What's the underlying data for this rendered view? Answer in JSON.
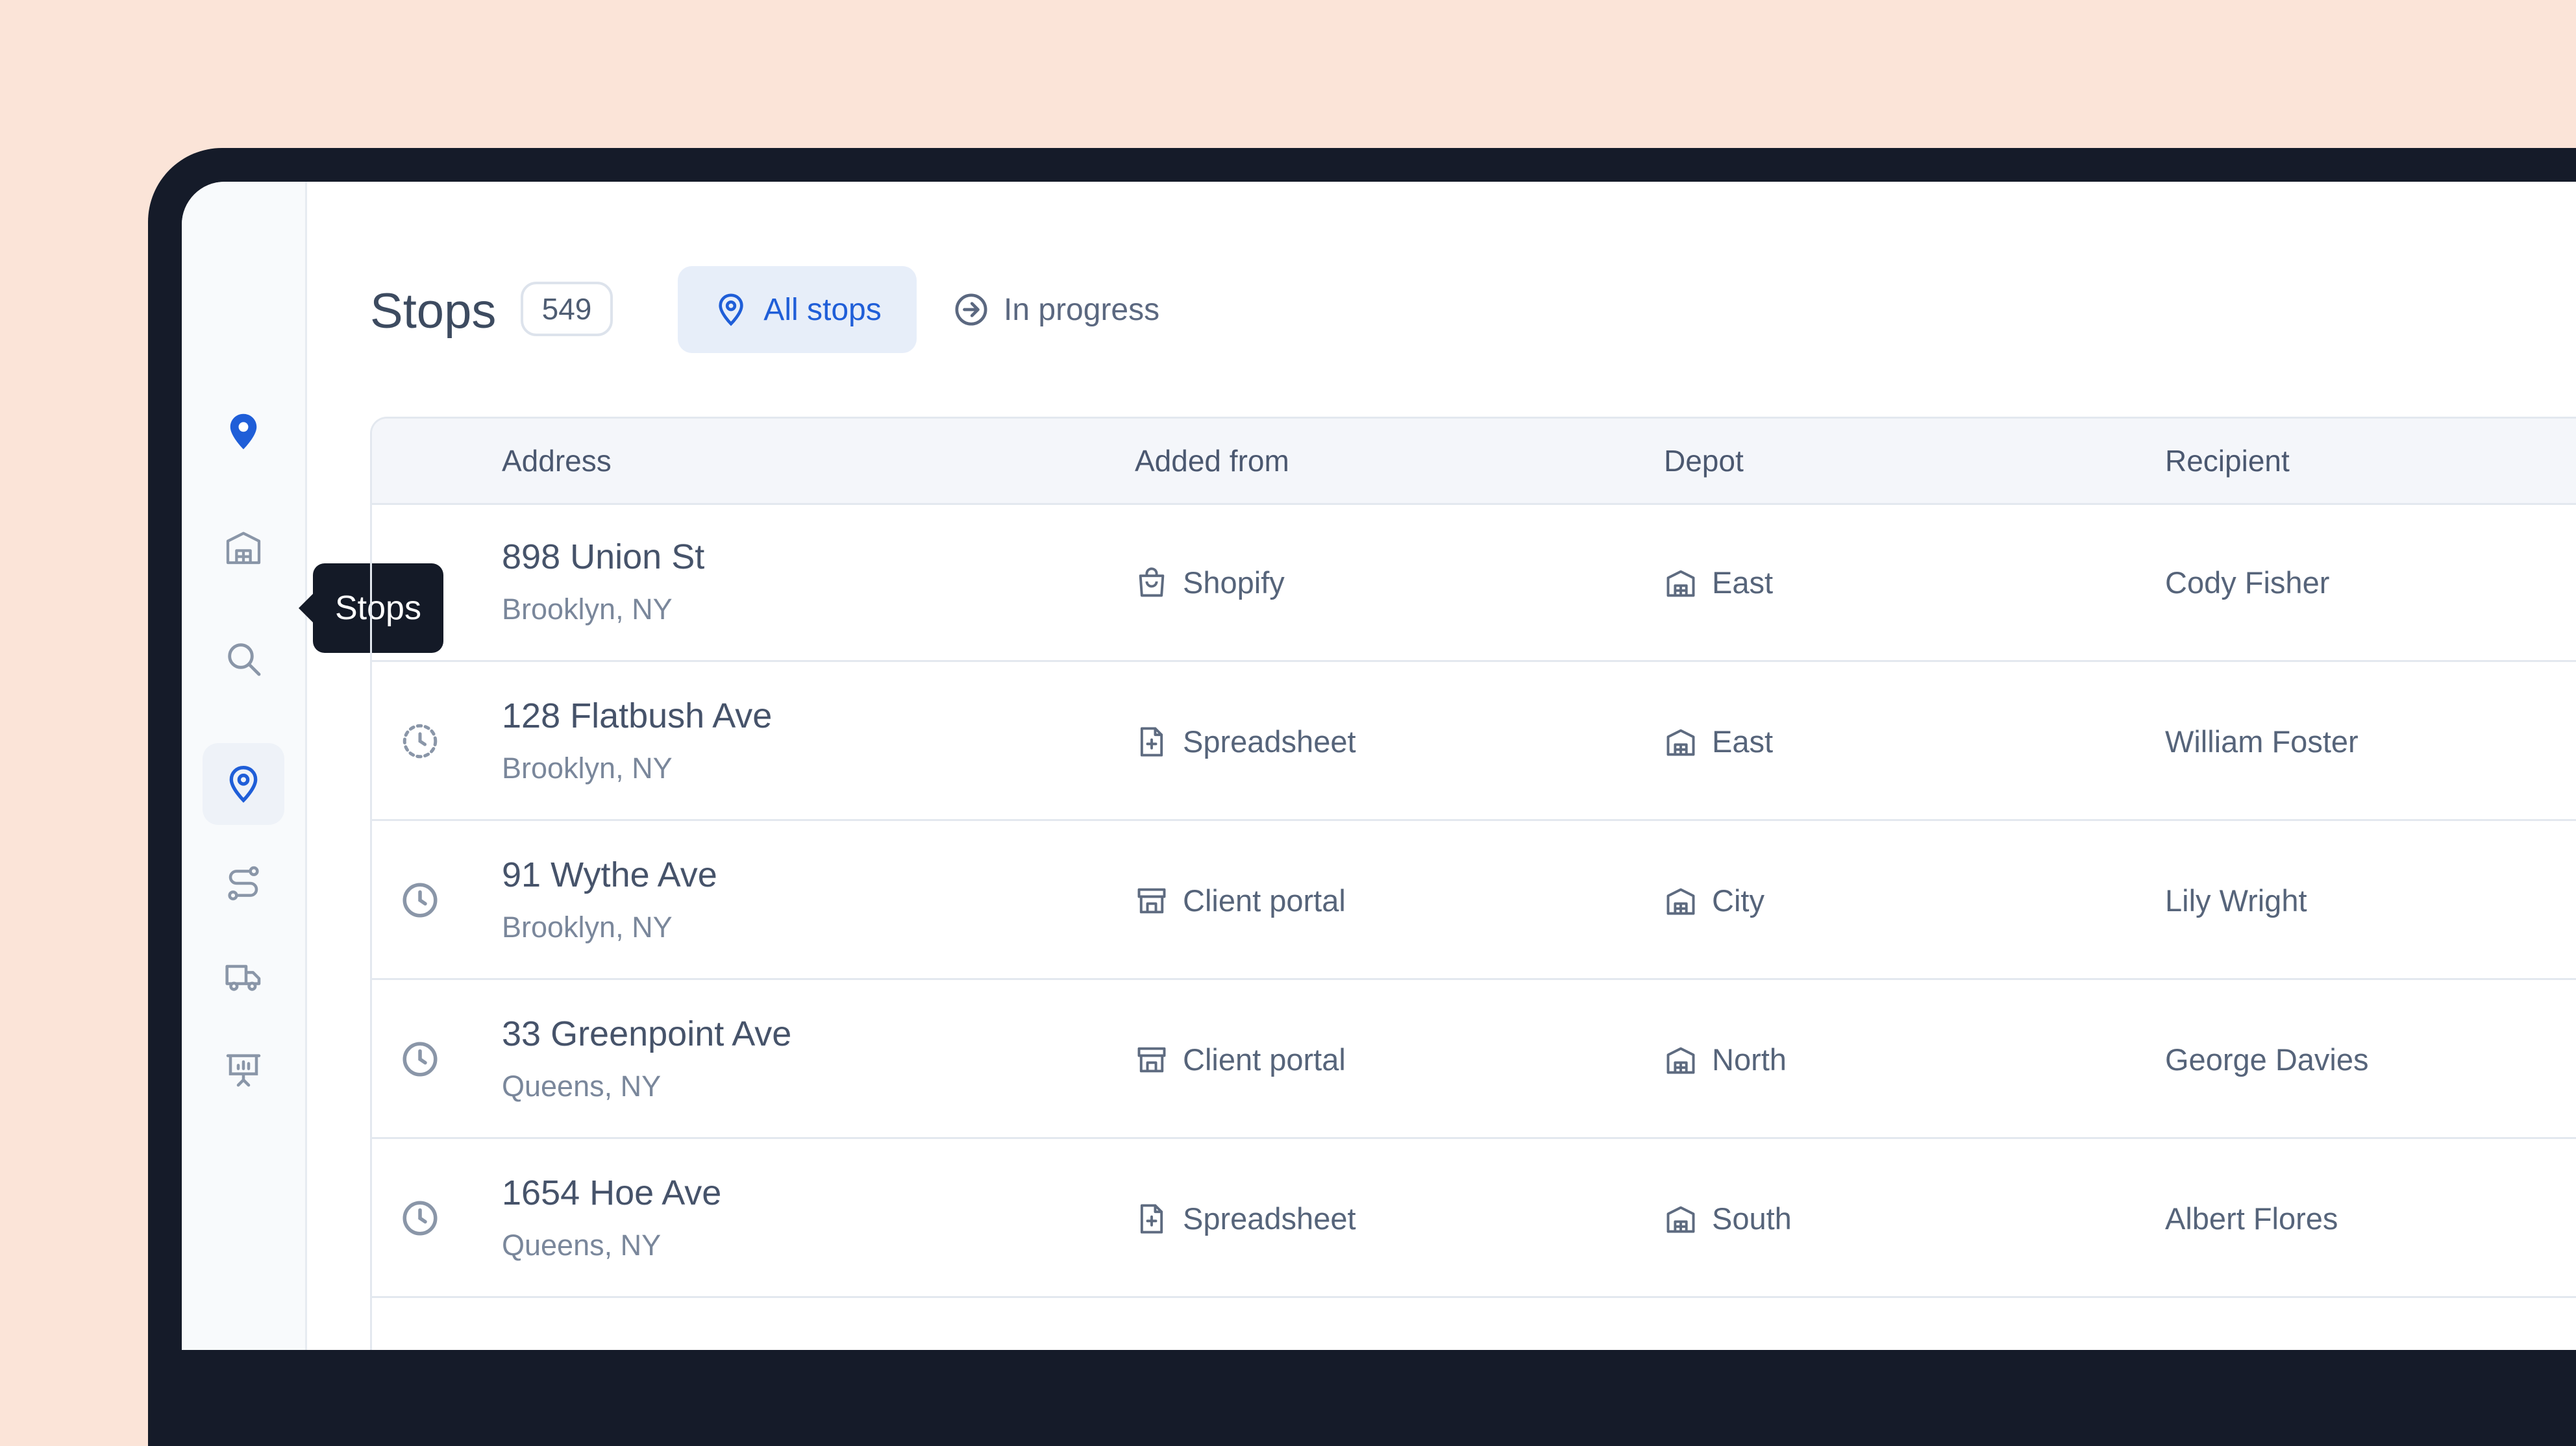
{
  "sidebar": {
    "items": [
      {
        "name": "logo",
        "icon": "map-pin-icon"
      },
      {
        "name": "depots",
        "icon": "warehouse-icon"
      },
      {
        "name": "search",
        "icon": "search-icon"
      },
      {
        "name": "stops",
        "icon": "map-pin-icon",
        "active": true
      },
      {
        "name": "routes",
        "icon": "route-icon"
      },
      {
        "name": "vehicles",
        "icon": "truck-icon"
      },
      {
        "name": "reports",
        "icon": "presentation-chart-icon"
      }
    ],
    "tooltip": "Stops"
  },
  "header": {
    "title": "Stops",
    "count": "549",
    "tabs": [
      {
        "label": "All stops",
        "icon": "map-pin-icon",
        "active": true
      },
      {
        "label": "In progress",
        "icon": "arrow-circle-right-icon",
        "active": false
      }
    ]
  },
  "table": {
    "columns": [
      "Address",
      "Added from",
      "Depot",
      "Recipient"
    ],
    "rows": [
      {
        "status": "none",
        "address": "898 Union St",
        "city": "Brooklyn, NY",
        "source": "Shopify",
        "source_icon": "shopping-bag-icon",
        "depot": "East",
        "recipient": "Cody Fisher"
      },
      {
        "status": "dashed-clock-icon",
        "address": "128 Flatbush Ave",
        "city": "Brooklyn, NY",
        "source": "Spreadsheet",
        "source_icon": "file-plus-icon",
        "depot": "East",
        "recipient": "William Foster"
      },
      {
        "status": "clock-icon",
        "address": "91 Wythe Ave",
        "city": "Brooklyn, NY",
        "source": "Client portal",
        "source_icon": "storefront-icon",
        "depot": "City",
        "recipient": "Lily Wright"
      },
      {
        "status": "clock-icon",
        "address": "33 Greenpoint Ave",
        "city": "Queens, NY",
        "source": "Client portal",
        "source_icon": "storefront-icon",
        "depot": "North",
        "recipient": "George Davies"
      },
      {
        "status": "clock-icon",
        "address": "1654 Hoe Ave",
        "city": "Queens, NY",
        "source": "Spreadsheet",
        "source_icon": "file-plus-icon",
        "depot": "South",
        "recipient": "Albert Flores"
      }
    ]
  },
  "colors": {
    "background": "#fbe4d8",
    "bezel": "#151b29",
    "accent": "#1f5ed8",
    "tooltip": "#141a27"
  }
}
